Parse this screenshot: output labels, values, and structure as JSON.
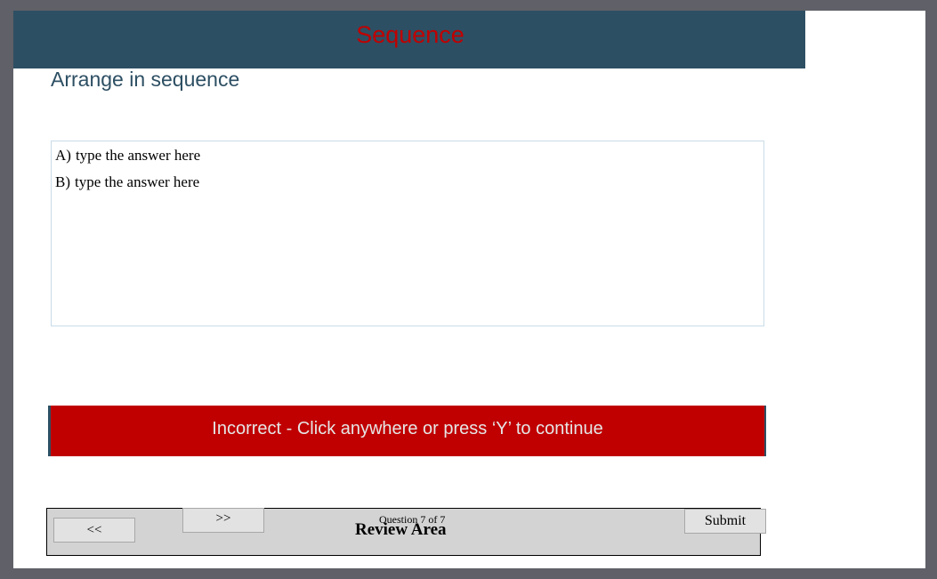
{
  "header": {
    "title": "Sequence"
  },
  "instruction": "Arrange in sequence",
  "answers": [
    {
      "letter": "A)",
      "text": "type the answer here"
    },
    {
      "letter": "B)",
      "text": "type the answer here"
    }
  ],
  "feedback": {
    "message": "Incorrect - Click anywhere or press ‘Y’ to continue"
  },
  "review": {
    "prev_label": "<<",
    "next_label": ">>",
    "counter": "Question 7 of 7",
    "title": "Review Area",
    "submit_label": "Submit"
  },
  "colors": {
    "header_bg": "#2d4f63",
    "title_red": "#c00000",
    "feedback_bg": "#c00000",
    "review_bg": "#d3d3d3",
    "frame_bg": "#5f6068"
  }
}
